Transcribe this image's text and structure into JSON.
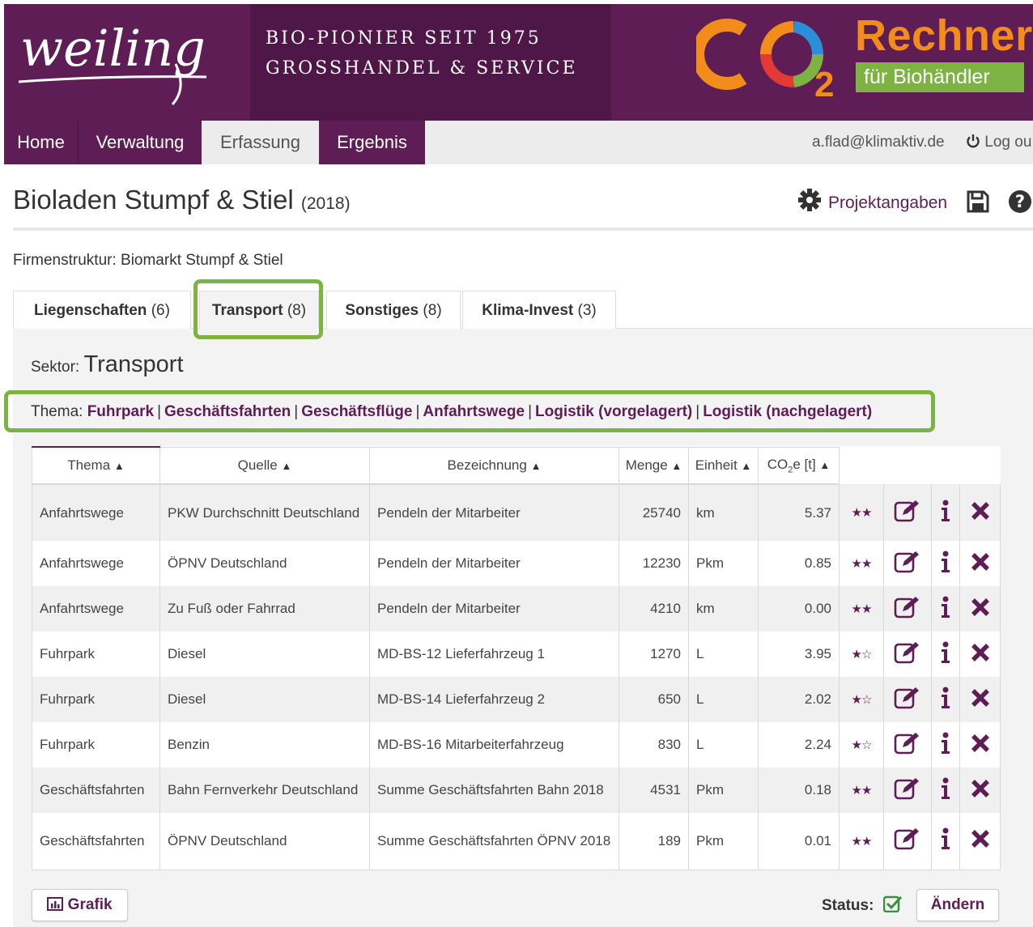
{
  "header": {
    "brand": "weiling",
    "tagline_1": "BIO-PIONIER SEIT 1975",
    "tagline_2": "GROSSHANDEL & SERVICE",
    "co2_main": "CO",
    "co2_sub": "2",
    "rechner": "Rechner",
    "fuer": "für Biohändler"
  },
  "nav": {
    "items": [
      {
        "label": "Home",
        "active": false
      },
      {
        "label": "Verwaltung",
        "active": false
      },
      {
        "label": "Erfassung",
        "active": true
      },
      {
        "label": "Ergebnis",
        "active": false
      }
    ],
    "user": "a.flad@klimaktiv.de",
    "logout": "Log ou"
  },
  "title": {
    "name": "Bioladen Stumpf & Stiel",
    "year": "(2018)",
    "projekt": "Projektangaben"
  },
  "firm": {
    "text": "Firmenstruktur: Biomarkt Stumpf & Stiel"
  },
  "tabs": [
    {
      "label": "Liegenschaften",
      "count": "(6)"
    },
    {
      "label": "Transport",
      "count": "(8)"
    },
    {
      "label": "Sonstiges",
      "count": "(8)"
    },
    {
      "label": "Klima-Invest",
      "count": "(3)"
    }
  ],
  "sector": {
    "prefix": "Sektor:",
    "name": "Transport"
  },
  "thema": {
    "prefix": "Thema:",
    "links": [
      "Fuhrpark",
      "Geschäftsfahrten",
      "Geschäftsflüge",
      "Anfahrtswege",
      "Logistik (vorgelagert)",
      "Logistik (nachgelagert)"
    ]
  },
  "table": {
    "headers": {
      "thema": "Thema",
      "quelle": "Quelle",
      "bezeichnung": "Bezeichnung",
      "menge": "Menge",
      "einheit": "Einheit",
      "co2_main": "CO",
      "co2_sub": "2",
      "co2_rest": "e [t]"
    },
    "rows": [
      {
        "thema": "Anfahrtswege",
        "quelle": "PKW Durchschnitt Deutschland",
        "bezeichnung": "Pendeln der Mitarbeiter",
        "menge": "25740",
        "einheit": "km",
        "co2": "5.37",
        "stars": "★★"
      },
      {
        "thema": "Anfahrtswege",
        "quelle": "ÖPNV Deutschland",
        "bezeichnung": "Pendeln der Mitarbeiter",
        "menge": "12230",
        "einheit": "Pkm",
        "co2": "0.85",
        "stars": "★★"
      },
      {
        "thema": "Anfahrtswege",
        "quelle": "Zu Fuß oder Fahrrad",
        "bezeichnung": "Pendeln der Mitarbeiter",
        "menge": "4210",
        "einheit": "km",
        "co2": "0.00",
        "stars": "★★"
      },
      {
        "thema": "Fuhrpark",
        "quelle": "Diesel",
        "bezeichnung": "MD-BS-12 Lieferfahrzeug 1",
        "menge": "1270",
        "einheit": "L",
        "co2": "3.95",
        "stars": "★☆"
      },
      {
        "thema": "Fuhrpark",
        "quelle": "Diesel",
        "bezeichnung": "MD-BS-14 Lieferfahrzeug 2",
        "menge": "650",
        "einheit": "L",
        "co2": "2.02",
        "stars": "★☆"
      },
      {
        "thema": "Fuhrpark",
        "quelle": "Benzin",
        "bezeichnung": "MD-BS-16 Mitarbeiterfahrzeug",
        "menge": "830",
        "einheit": "L",
        "co2": "2.24",
        "stars": "★☆"
      },
      {
        "thema": "Geschäftsfahrten",
        "quelle": "Bahn Fernverkehr Deutschland",
        "bezeichnung": "Summe Geschäftsfahrten Bahn 2018",
        "menge": "4531",
        "einheit": "Pkm",
        "co2": "0.18",
        "stars": "★★"
      },
      {
        "thema": "Geschäftsfahrten",
        "quelle": "ÖPNV Deutschland",
        "bezeichnung": "Summe Geschäftsfahrten ÖPNV 2018",
        "menge": "189",
        "einheit": "Pkm",
        "co2": "0.01",
        "stars": "★★"
      }
    ]
  },
  "bottom": {
    "grafik": "Grafik",
    "status": "Status:",
    "aendern": "Ändern"
  },
  "colors": {
    "brand_purple": "#5e1d55",
    "brand_green": "#7cb342",
    "brand_orange": "#f28c1b"
  },
  "icons": {
    "settings": "gear-icon",
    "save": "save-icon",
    "help": "help-icon",
    "logout": "power-icon",
    "sort": "sort-icon",
    "edit": "edit-icon",
    "info": "info-icon",
    "delete": "delete-icon",
    "chart": "bar-chart-icon",
    "status": "checkbox-checked-icon"
  }
}
